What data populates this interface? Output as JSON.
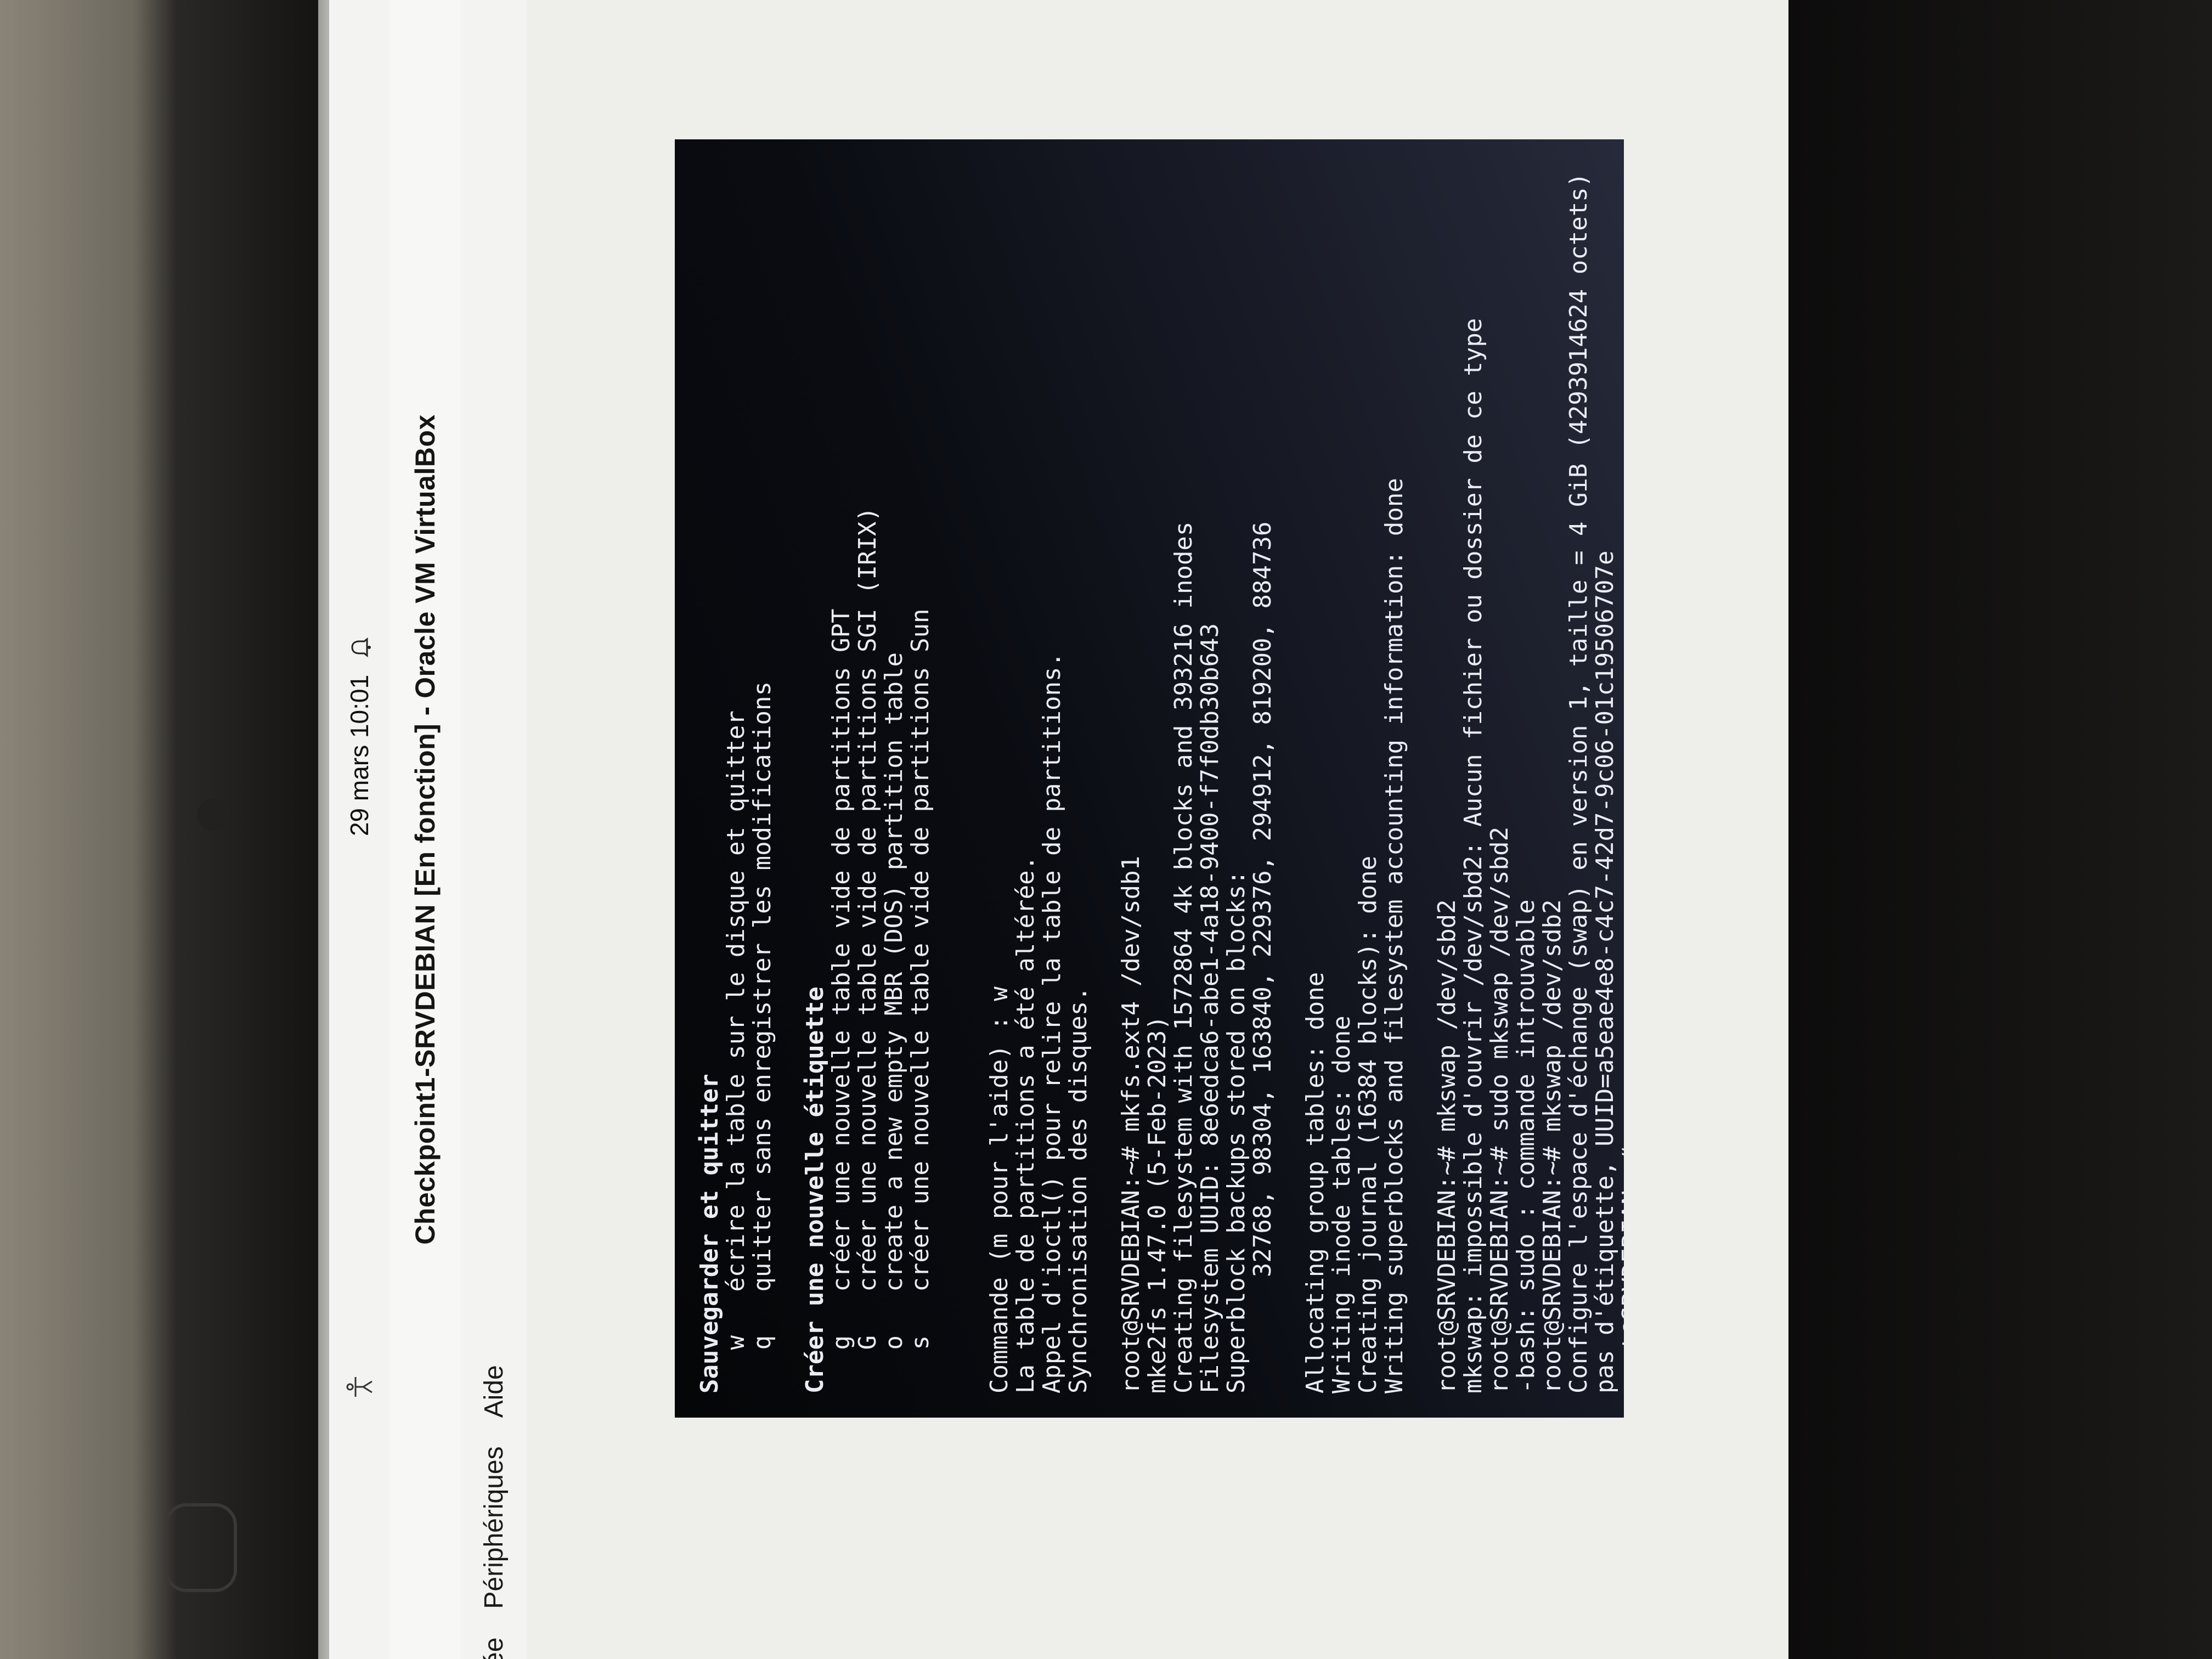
{
  "topbar": {
    "clock": "29 mars 10:01",
    "notification_icon": "bell-icon",
    "accessibility_icon": "accessibility-icon"
  },
  "window": {
    "title": "Checkpoint1-SRVDEBIAN [En fonction] - Oracle VM VirtualBox"
  },
  "menubar": {
    "items": [
      "ée",
      "Périphériques",
      "Aide"
    ]
  },
  "console": {
    "lines": [
      {
        "text": "Sauvegarder et quitter",
        "style": "bold"
      },
      {
        "text": "   w   écrire la table sur le disque et quitter",
        "style": ""
      },
      {
        "text": "   q   quitter sans enregistrer les modifications",
        "style": ""
      },
      {
        "text": "",
        "style": "blank"
      },
      {
        "text": "Créer une nouvelle étiquette",
        "style": "bold"
      },
      {
        "text": "   g   créer une nouvelle table vide de partitions GPT",
        "style": ""
      },
      {
        "text": "   G   créer une nouvelle table vide de partitions SGI (IRIX)",
        "style": ""
      },
      {
        "text": "   o   create a new empty MBR (DOS) partition table",
        "style": ""
      },
      {
        "text": "   s   créer une nouvelle table vide de partitions Sun",
        "style": ""
      },
      {
        "text": "",
        "style": "blank"
      },
      {
        "text": "",
        "style": "blank"
      },
      {
        "text": "Commande (m pour l'aide) : w",
        "style": ""
      },
      {
        "text": "La table de partitions a été altérée.",
        "style": ""
      },
      {
        "text": "Appel d'ioctl() pour relire la table de partitions.",
        "style": ""
      },
      {
        "text": "Synchronisation des disques.",
        "style": ""
      },
      {
        "text": "",
        "style": "blank"
      },
      {
        "text": "root@SRVDEBIAN:~# mkfs.ext4 /dev/sdb1",
        "style": ""
      },
      {
        "text": "mke2fs 1.47.0 (5-Feb-2023)",
        "style": ""
      },
      {
        "text": "Creating filesystem with 1572864 4k blocks and 393216 inodes",
        "style": ""
      },
      {
        "text": "Filesystem UUID: 8e6edca6-abe1-4a18-9400-f7f0db30b643",
        "style": ""
      },
      {
        "text": "Superblock backups stored on blocks:",
        "style": ""
      },
      {
        "text": "        32768, 98304, 163840, 229376, 294912, 819200, 884736",
        "style": ""
      },
      {
        "text": "",
        "style": "blank"
      },
      {
        "text": "Allocating group tables: done",
        "style": ""
      },
      {
        "text": "Writing inode tables: done",
        "style": ""
      },
      {
        "text": "Creating journal (16384 blocks): done",
        "style": ""
      },
      {
        "text": "Writing superblocks and filesystem accounting information: done",
        "style": ""
      },
      {
        "text": "",
        "style": "blank"
      },
      {
        "text": "root@SRVDEBIAN:~# mkswap /dev/sbd2",
        "style": ""
      },
      {
        "text": "mkswap: impossible d'ouvrir /dev/sbd2: Aucun fichier ou dossier de ce type",
        "style": ""
      },
      {
        "text": "root@SRVDEBIAN:~# sudo mkswap /dev/sbd2",
        "style": ""
      },
      {
        "text": "-bash: sudo : commande introuvable",
        "style": ""
      },
      {
        "text": "root@SRVDEBIAN:~# mkswap /dev/sdb2",
        "style": ""
      },
      {
        "text": "Configure l'espace d'échange (swap) en version 1, taille = 4 GiB (4293914624 octets)",
        "style": ""
      },
      {
        "text": "pas d'étiquette, UUID=a5eae4e8-c4c7-42d7-9c06-01c19506707e",
        "style": ""
      },
      {
        "text": "root@SRVDEBIAN:~#",
        "style": ""
      }
    ]
  }
}
